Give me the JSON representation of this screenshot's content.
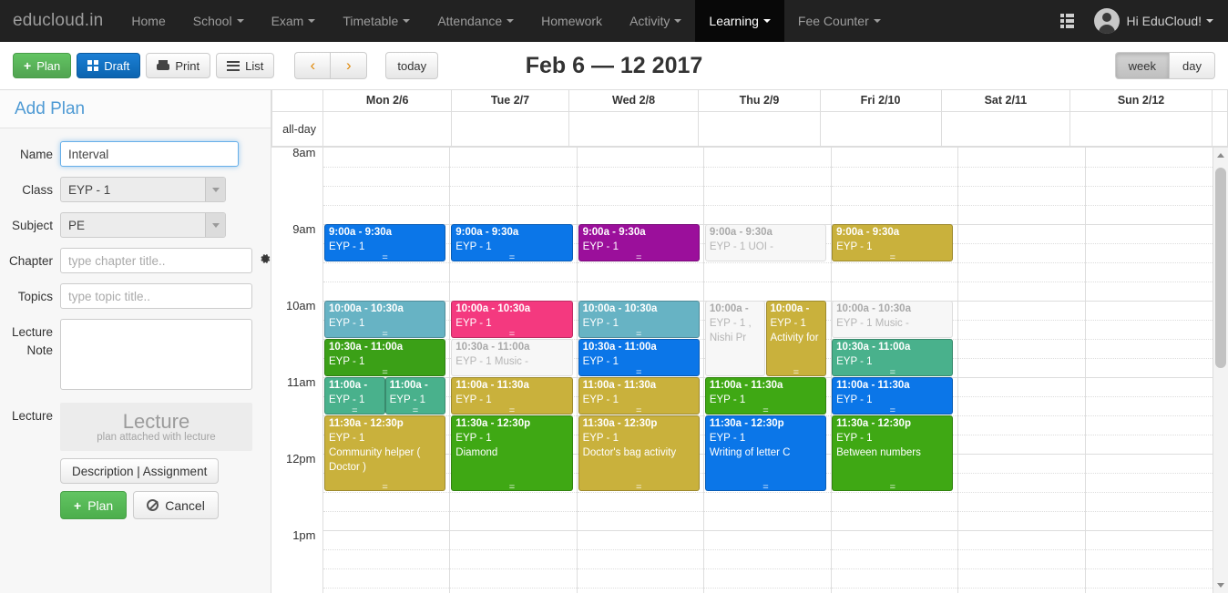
{
  "navbar": {
    "brand": "educloud.in",
    "items": [
      {
        "label": "Home",
        "caret": false,
        "active": false
      },
      {
        "label": "School",
        "caret": true,
        "active": false
      },
      {
        "label": "Exam",
        "caret": true,
        "active": false
      },
      {
        "label": "Timetable",
        "caret": true,
        "active": false
      },
      {
        "label": "Attendance",
        "caret": true,
        "active": false
      },
      {
        "label": "Homework",
        "caret": false,
        "active": false
      },
      {
        "label": "Activity",
        "caret": true,
        "active": false
      },
      {
        "label": "Learning",
        "caret": true,
        "active": true
      },
      {
        "label": "Fee Counter",
        "caret": true,
        "active": false
      }
    ],
    "grid_icon": "grid-menu-icon",
    "user_label": "Hi EduCloud!",
    "avatar_icon": "user-avatar-icon"
  },
  "toolbar": {
    "plan_label": "Plan",
    "draft_label": "Draft",
    "print_label": "Print",
    "list_label": "List",
    "prev_label": "‹",
    "next_label": "›",
    "today_label": "today",
    "title": "Feb 6 — 12 2017",
    "view_week": "week",
    "view_day": "day",
    "active_view": "week"
  },
  "sidebar": {
    "title": "Add Plan",
    "fields": {
      "name_label": "Name",
      "name_value": "Interval",
      "class_label": "Class",
      "class_value": "EYP - 1",
      "subject_label": "Subject",
      "subject_value": "PE",
      "chapter_label": "Chapter",
      "chapter_placeholder": "type chapter title..",
      "chapter_value": "",
      "topics_label": "Topics",
      "topics_placeholder": "type topic title..",
      "topics_value": "",
      "note_label_line1": "Lecture",
      "note_label_line2": "Note",
      "note_value": "",
      "lecture_label": "Lecture",
      "lecture_box_title": "Lecture",
      "lecture_box_sub": "plan attached with lecture"
    },
    "buttons": {
      "description_assignment": "Description | Assignment",
      "plan": "Plan",
      "cancel": "Cancel"
    }
  },
  "calendar": {
    "allday_label": "all-day",
    "days": [
      {
        "label": "Mon 2/6"
      },
      {
        "label": "Tue 2/7"
      },
      {
        "label": "Wed 2/8"
      },
      {
        "label": "Thu 2/9"
      },
      {
        "label": "Fri 2/10"
      },
      {
        "label": "Sat 2/11"
      },
      {
        "label": "Sun 2/12"
      }
    ],
    "time_labels": [
      "8am",
      "9am",
      "10am",
      "11am",
      "12pm",
      "1pm"
    ],
    "colors": {
      "blue": "#0b76e8",
      "purple": "#9b0f9b",
      "gold": "#c9b13c",
      "teal": "#67b3c4",
      "pink": "#f4397f",
      "green_dark": "#3ba017",
      "green": "#3fa814",
      "seagreen": "#49b18c",
      "ghost_bg": "#f7f7f7",
      "ghost_text": "#b5b5b5"
    },
    "events": [
      {
        "day": 0,
        "start": "9:00a",
        "end": "9:30a",
        "time": "9:00a - 9:30a",
        "title": "EYP - 1",
        "extra": "",
        "color": "blue",
        "ghost": false,
        "lane": 0,
        "lanes": 1
      },
      {
        "day": 0,
        "start": "10:00a",
        "end": "10:30a",
        "time": "10:00a - 10:30a",
        "title": "EYP - 1",
        "extra": "",
        "color": "teal",
        "ghost": false,
        "lane": 0,
        "lanes": 1
      },
      {
        "day": 0,
        "start": "10:30a",
        "end": "11:00a",
        "time": "10:30a - 11:00a",
        "title": "EYP - 1",
        "extra": "",
        "color": "green_dark",
        "ghost": false,
        "lane": 0,
        "lanes": 1
      },
      {
        "day": 0,
        "start": "11:00a",
        "end": "11:30a",
        "time": "11:00a -",
        "title": "EYP - 1",
        "extra": "",
        "color": "seagreen",
        "ghost": false,
        "lane": 0,
        "lanes": 2
      },
      {
        "day": 0,
        "start": "11:00a",
        "end": "11:30a",
        "time": "11:00a -",
        "title": "EYP - 1",
        "extra": "",
        "color": "seagreen",
        "ghost": false,
        "lane": 1,
        "lanes": 2
      },
      {
        "day": 0,
        "start": "11:30a",
        "end": "12:30p",
        "time": "11:30a - 12:30p",
        "title": "EYP - 1",
        "extra": "Community helper ( Doctor )",
        "color": "gold",
        "ghost": false,
        "lane": 0,
        "lanes": 1
      },
      {
        "day": 1,
        "start": "9:00a",
        "end": "9:30a",
        "time": "9:00a - 9:30a",
        "title": "EYP - 1",
        "extra": "",
        "color": "blue",
        "ghost": false,
        "lane": 0,
        "lanes": 1
      },
      {
        "day": 1,
        "start": "10:00a",
        "end": "10:30a",
        "time": "10:00a - 10:30a",
        "title": "EYP - 1",
        "extra": "",
        "color": "pink",
        "ghost": false,
        "lane": 0,
        "lanes": 1
      },
      {
        "day": 1,
        "start": "10:30a",
        "end": "11:00a",
        "time": "10:30a - 11:00a",
        "title": "EYP - 1 Music -",
        "extra": "",
        "color": "ghost",
        "ghost": true,
        "lane": 0,
        "lanes": 1
      },
      {
        "day": 1,
        "start": "11:00a",
        "end": "11:30a",
        "time": "11:00a - 11:30a",
        "title": "EYP - 1",
        "extra": "",
        "color": "gold",
        "ghost": false,
        "lane": 0,
        "lanes": 1
      },
      {
        "day": 1,
        "start": "11:30a",
        "end": "12:30p",
        "time": "11:30a - 12:30p",
        "title": "EYP - 1",
        "extra": "Diamond",
        "color": "green",
        "ghost": false,
        "lane": 0,
        "lanes": 1
      },
      {
        "day": 2,
        "start": "9:00a",
        "end": "9:30a",
        "time": "9:00a - 9:30a",
        "title": "EYP - 1",
        "extra": "",
        "color": "purple",
        "ghost": false,
        "lane": 0,
        "lanes": 1
      },
      {
        "day": 2,
        "start": "10:00a",
        "end": "10:30a",
        "time": "10:00a - 10:30a",
        "title": "EYP - 1",
        "extra": "",
        "color": "teal",
        "ghost": false,
        "lane": 0,
        "lanes": 1
      },
      {
        "day": 2,
        "start": "10:30a",
        "end": "11:00a",
        "time": "10:30a - 11:00a",
        "title": "EYP - 1",
        "extra": "",
        "color": "blue",
        "ghost": false,
        "lane": 0,
        "lanes": 1
      },
      {
        "day": 2,
        "start": "11:00a",
        "end": "11:30a",
        "time": "11:00a - 11:30a",
        "title": "EYP - 1",
        "extra": "",
        "color": "gold",
        "ghost": false,
        "lane": 0,
        "lanes": 1
      },
      {
        "day": 2,
        "start": "11:30a",
        "end": "12:30p",
        "time": "11:30a - 12:30p",
        "title": "EYP - 1",
        "extra": "Doctor's bag activity",
        "color": "gold",
        "ghost": false,
        "lane": 0,
        "lanes": 1
      },
      {
        "day": 3,
        "start": "9:00a",
        "end": "9:30a",
        "time": "9:00a - 9:30a",
        "title": "EYP - 1 UOI -",
        "extra": "",
        "color": "ghost",
        "ghost": true,
        "lane": 0,
        "lanes": 1
      },
      {
        "day": 3,
        "start": "10:00a",
        "end": "11:00a",
        "time": "10:00a -",
        "title": "EYP - 1 ,",
        "extra": "Nishi Pr",
        "color": "ghost",
        "ghost": true,
        "lane": 0,
        "lanes": 2
      },
      {
        "day": 3,
        "start": "10:00a",
        "end": "11:00a",
        "time": "10:00a -",
        "title": "EYP - 1",
        "extra": "Activity for",
        "color": "gold",
        "ghost": false,
        "lane": 1,
        "lanes": 2
      },
      {
        "day": 3,
        "start": "11:00a",
        "end": "11:30a",
        "time": "11:00a - 11:30a",
        "title": "EYP - 1",
        "extra": "",
        "color": "green",
        "ghost": false,
        "lane": 0,
        "lanes": 1
      },
      {
        "day": 3,
        "start": "11:30a",
        "end": "12:30p",
        "time": "11:30a - 12:30p",
        "title": "EYP - 1",
        "extra": "Writing of letter C",
        "color": "blue",
        "ghost": false,
        "lane": 0,
        "lanes": 1
      },
      {
        "day": 4,
        "start": "9:00a",
        "end": "9:30a",
        "time": "9:00a - 9:30a",
        "title": "EYP - 1",
        "extra": "",
        "color": "gold",
        "ghost": false,
        "lane": 0,
        "lanes": 1
      },
      {
        "day": 4,
        "start": "10:00a",
        "end": "10:30a",
        "time": "10:00a - 10:30a",
        "title": "EYP - 1 Music -",
        "extra": "",
        "color": "ghost",
        "ghost": true,
        "lane": 0,
        "lanes": 1
      },
      {
        "day": 4,
        "start": "10:30a",
        "end": "11:00a",
        "time": "10:30a - 11:00a",
        "title": "EYP - 1",
        "extra": "",
        "color": "seagreen",
        "ghost": false,
        "lane": 0,
        "lanes": 1
      },
      {
        "day": 4,
        "start": "11:00a",
        "end": "11:30a",
        "time": "11:00a - 11:30a",
        "title": "EYP - 1",
        "extra": "",
        "color": "blue",
        "ghost": false,
        "lane": 0,
        "lanes": 1
      },
      {
        "day": 4,
        "start": "11:30a",
        "end": "12:30p",
        "time": "11:30a - 12:30p",
        "title": "EYP - 1",
        "extra": "Between numbers",
        "color": "green",
        "ghost": false,
        "lane": 0,
        "lanes": 1
      }
    ]
  }
}
